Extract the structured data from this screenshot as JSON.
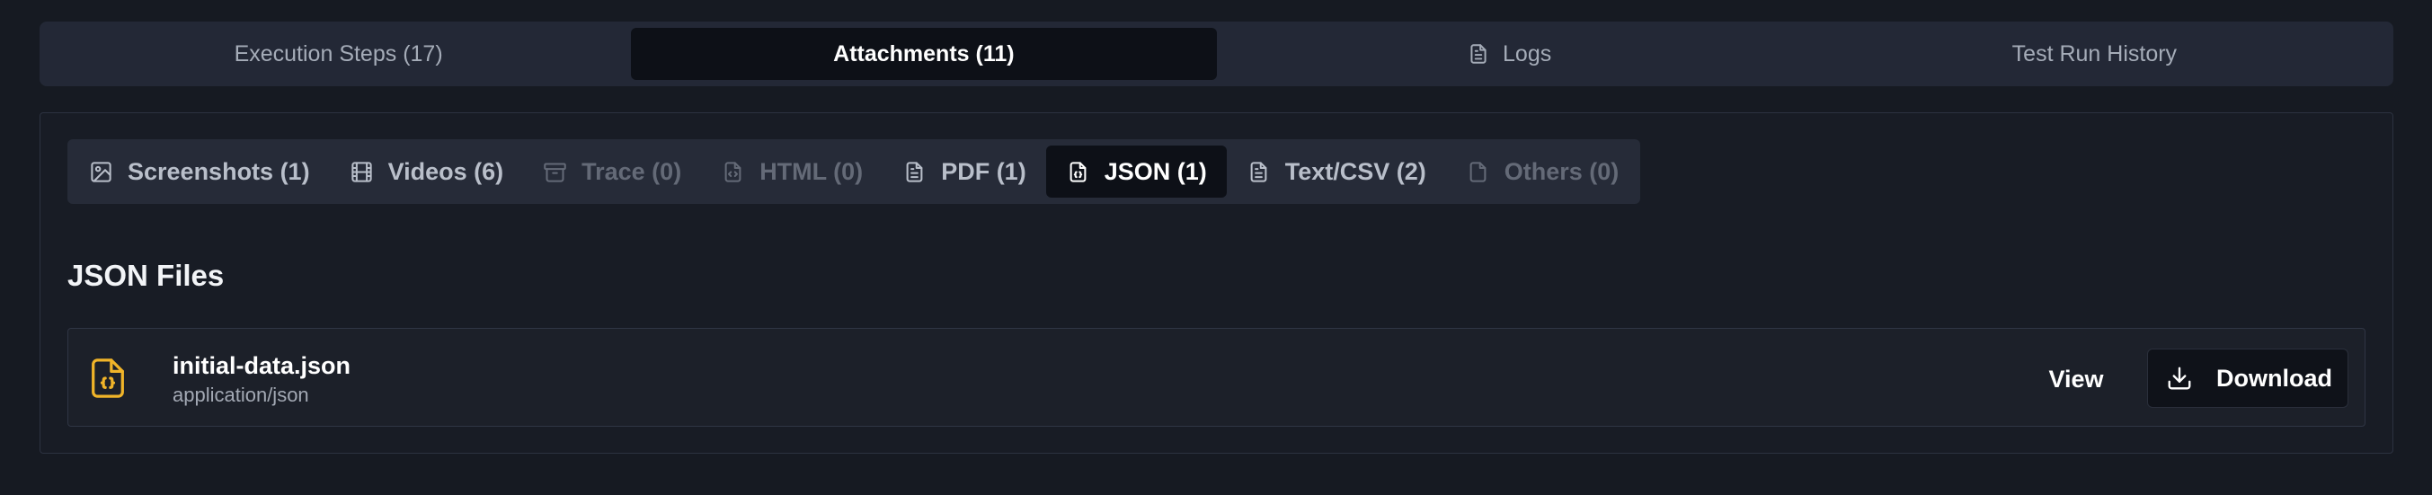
{
  "top_tabs": [
    {
      "label": "Execution Steps (17)",
      "active": false
    },
    {
      "label": "Attachments (11)",
      "active": true
    },
    {
      "label": "Logs",
      "icon": "file-text-icon",
      "active": false
    },
    {
      "label": "Test Run History",
      "active": false
    }
  ],
  "sub_tabs": [
    {
      "label": "Screenshots (1)",
      "icon": "image-icon",
      "state": "normal"
    },
    {
      "label": "Videos (6)",
      "icon": "film-icon",
      "state": "normal"
    },
    {
      "label": "Trace (0)",
      "icon": "archive-icon",
      "state": "disabled"
    },
    {
      "label": "HTML (0)",
      "icon": "file-code-icon",
      "state": "disabled"
    },
    {
      "label": "PDF (1)",
      "icon": "file-text-icon",
      "state": "normal"
    },
    {
      "label": "JSON (1)",
      "icon": "file-json-icon",
      "state": "active"
    },
    {
      "label": "Text/CSV (2)",
      "icon": "file-text-icon",
      "state": "normal"
    },
    {
      "label": "Others (0)",
      "icon": "file-icon",
      "state": "disabled"
    }
  ],
  "section": {
    "title": "JSON Files"
  },
  "files": [
    {
      "name": "initial-data.json",
      "type": "application/json",
      "icon": "file-json-icon",
      "view_label": "View",
      "download_label": "Download"
    }
  ],
  "colors": {
    "background": "#161a22",
    "tab_bar": "#232836",
    "active_tab": "#0d1017",
    "json_icon": "#f0b429"
  }
}
